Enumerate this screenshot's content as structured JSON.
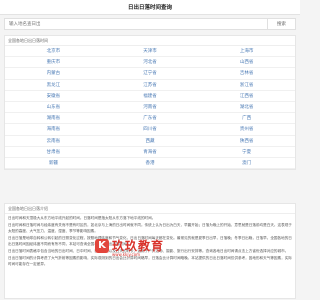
{
  "header": {
    "title": "日出日落时间查询"
  },
  "search": {
    "placeholder": "输入地名查日出",
    "button_label": "搜索"
  },
  "provinces": {
    "heading": "全国各地日出日落时间",
    "items": [
      "北京市",
      "天津市",
      "上海市",
      "重庆市",
      "河北省",
      "山西省",
      "内蒙古",
      "辽宁省",
      "吉林省",
      "黑龙江",
      "江苏省",
      "浙江省",
      "安徽省",
      "福建省",
      "江西省",
      "山东省",
      "河南省",
      "湖北省",
      "湖南省",
      "广东省",
      "广西",
      "海南省",
      "四川省",
      "贵州省",
      "云南省",
      "西藏",
      "陕西省",
      "甘肃省",
      "青海省",
      "宁夏",
      "新疆",
      "香港",
      "澳门"
    ]
  },
  "info": {
    "heading": "全国各地日出日落介绍",
    "intro": "日出时间和天顶极大从东方地平线升起的时间。日落时间是指太阳从东方落下地平线的时间。",
    "paragraphs": [
      "日出时间和日落时间与经纬度有关而不是有时区的，如北京与上海的日出时间就不同。传统上认为日出为白天，早晨开始；日落为晚上的开始，意思就是日落前均是白天。这表现于太阳的高度、大气压力、温度、湿度、季节等影响因素。",
      "日出日落是地球自转和公转引起的日照变化过程，按照地理纬度和节气变化，日出日落时间每天都在变化。最常见的就是夏季日出早，日落晚；冬季日出晚，日落早。全国各地的日出日落时间因经纬度不同而有所不同，本站可查询全国各地的日出日落时间。",
      "日出日落时间表格中包含当地的日出时间、日中时间、日落时间以及白天的时长，适用于户外活动、摄影、旅行出行安排等。查询各地日出时间请点击上方省份选择对应的城市。",
      "日出日落时间的计算考虑了大气折射等因素的影响，实际观测到的日出会比计算时间略早，日落会比计算时间略晚。本站提供的日出日落时间仅供参考，因地形和天气等因素，实际时间可能存在一定差异。"
    ],
    "link_text": "日出日落时间查询"
  },
  "watermark": {
    "logo_char": "K",
    "text": "玖玖教育",
    "sub": "www.kkjy.com"
  }
}
